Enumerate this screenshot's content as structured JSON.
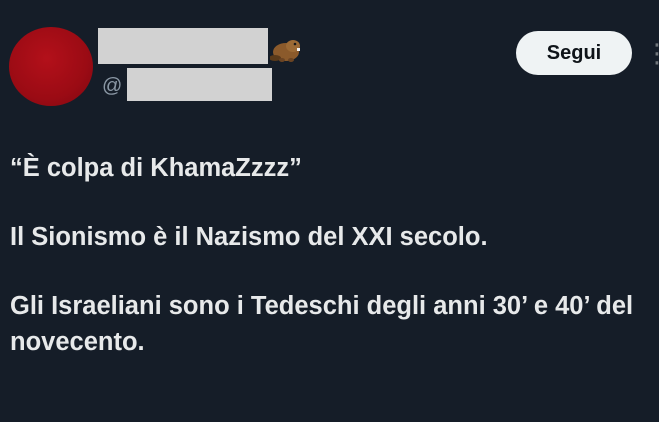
{
  "follow_label": "Segui",
  "handle_prefix": "@",
  "tweet": {
    "line1": "“È colpa di KhamaZzzz”",
    "line2": "Il Sionismo è il Nazismo del XXI secolo.",
    "line3": "Gli Israeliani sono i Tedeschi degli anni 30’ e 40’ del novecento."
  },
  "colors": {
    "background": "#151d28",
    "text": "#e7e9ea",
    "avatar": "#9b0b14",
    "button_bg": "#eff3f4"
  },
  "icons": {
    "name_badge": "beaver-emoji-icon",
    "more": "more-options-icon"
  }
}
